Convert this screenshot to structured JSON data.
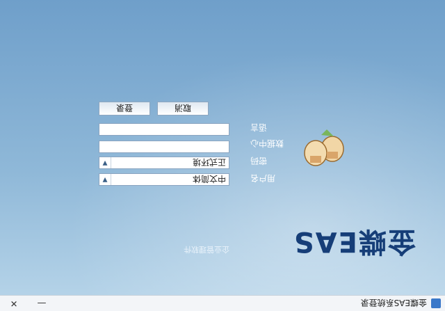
{
  "window": {
    "title": "金蝶EAS系统登录",
    "minimize_glyph": "—",
    "close_glyph": "✕"
  },
  "brand": {
    "logo_text": "金蝶EAS",
    "tagline": "企业管理软件"
  },
  "form": {
    "user_label": "用户名",
    "password_label": "密码",
    "datacenter_label": "数据中心",
    "language_label": "语言",
    "datacenter_value": "正式环境",
    "language_value": "中文简体"
  },
  "buttons": {
    "login": "登录",
    "cancel": "取消"
  },
  "colors": {
    "logo": "#163e78",
    "background_top": "#b9d6ea",
    "background_bottom": "#6f9fca"
  }
}
